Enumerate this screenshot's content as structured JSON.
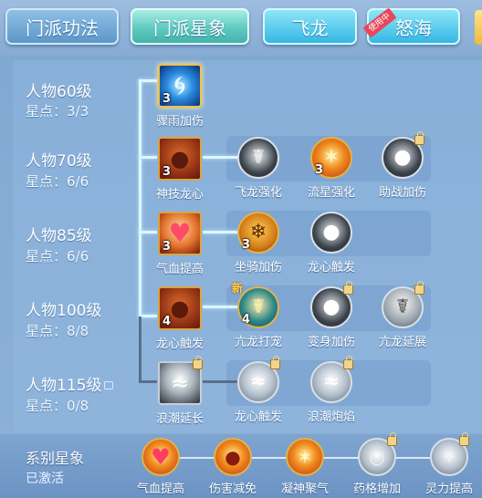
{
  "tabs": [
    {
      "label": "门派功法"
    },
    {
      "label": "门派星象"
    },
    {
      "label": "飞龙"
    },
    {
      "label": "怒海",
      "badge": "使用中"
    }
  ],
  "levels": [
    {
      "title": "人物60级",
      "stars": "星点：3/3"
    },
    {
      "title": "人物70级",
      "stars": "星点：6/6"
    },
    {
      "title": "人物85级",
      "stars": "星点：6/6"
    },
    {
      "title": "人物100级",
      "stars": "星点：8/8"
    },
    {
      "title": "人物115级",
      "stars": "星点：0/8",
      "locked": true
    }
  ],
  "skills": {
    "row1": [
      {
        "name": "骤雨加伤",
        "count": "3"
      }
    ],
    "row2": [
      {
        "name": "神技龙心",
        "count": "3"
      },
      {
        "name": "飞龙强化",
        "count": ""
      },
      {
        "name": "流星强化",
        "count": "3"
      },
      {
        "name": "助战加伤",
        "count": "",
        "locked": true
      }
    ],
    "row3": [
      {
        "name": "气血提高",
        "count": "3"
      },
      {
        "name": "坐骑加伤",
        "count": "3"
      },
      {
        "name": "龙心触发",
        "count": ""
      }
    ],
    "row4": [
      {
        "name": "龙心触发",
        "count": "4"
      },
      {
        "name": "亢龙打宠",
        "count": "4",
        "new": "新"
      },
      {
        "name": "变身加伤",
        "count": "",
        "locked": true
      },
      {
        "name": "亢龙延展",
        "count": "",
        "locked": true
      }
    ],
    "row5": [
      {
        "name": "浪潮延长",
        "count": "",
        "locked": true
      },
      {
        "name": "龙心触发",
        "count": "",
        "locked": true
      },
      {
        "name": "浪潮炮焰",
        "count": "",
        "locked": true
      }
    ]
  },
  "series": {
    "title": "系别星象",
    "status": "已激活",
    "items": [
      {
        "name": "气血提高"
      },
      {
        "name": "伤害减免"
      },
      {
        "name": "凝神聚气"
      },
      {
        "name": "药格增加",
        "locked": true
      },
      {
        "name": "灵力提高",
        "locked": true
      }
    ]
  }
}
